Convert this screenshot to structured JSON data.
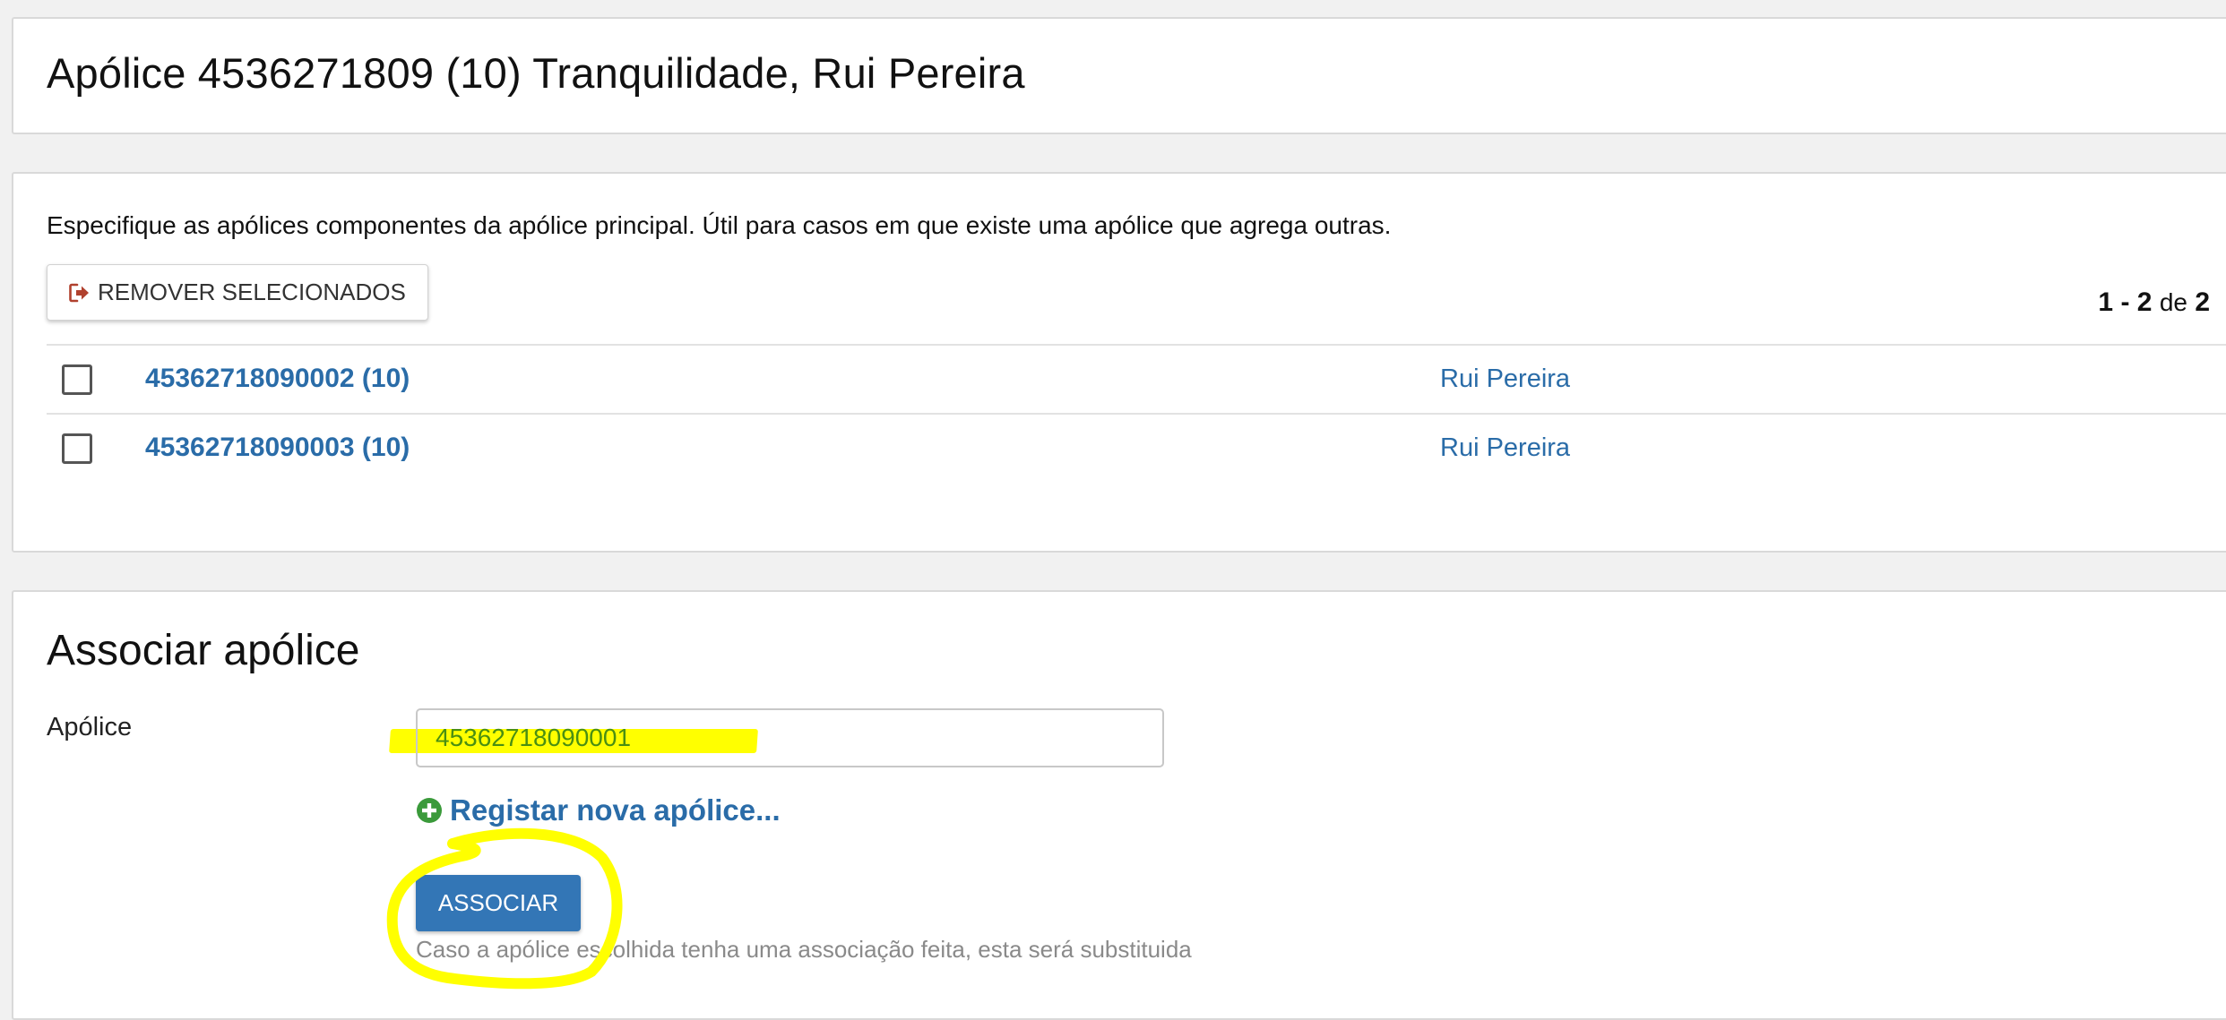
{
  "header": {
    "title_policy": "Apólice 4536271809 (10)",
    "title_insurer": "Tranquilidade, Rui Pereira"
  },
  "components": {
    "description": "Especifique as apólices componentes da apólice principal. Útil para casos em que existe uma apólice que agrega outras.",
    "remove_button": {
      "label": "REMOVER SELECIONADOS",
      "icon": "sign-out-icon"
    },
    "pagination": {
      "from": "1",
      "separator": "-",
      "to": "2",
      "of_label": "de",
      "total": "2"
    },
    "rows": [
      {
        "policy": "45362718090002 (10)",
        "holder": "Rui Pereira",
        "checked": false
      },
      {
        "policy": "45362718090003 (10)",
        "holder": "Rui Pereira",
        "checked": false
      }
    ]
  },
  "associate": {
    "title": "Associar apólice",
    "field_label": "Apólice",
    "policy_value": "45362718090001",
    "register_link": {
      "label": "Registar nova apólice...",
      "icon": "plus-circle-icon"
    },
    "submit_label": "ASSOCIAR",
    "help_text": "Caso a apólice escolhida tenha uma associação feita, esta será substituida"
  },
  "colors": {
    "link": "#2a6ca8",
    "primary_button": "#3376b6",
    "input_text": "#4a8f12",
    "highlight": "#ffff00",
    "add_icon": "#3a9a3a",
    "remove_icon": "#b0412e"
  }
}
